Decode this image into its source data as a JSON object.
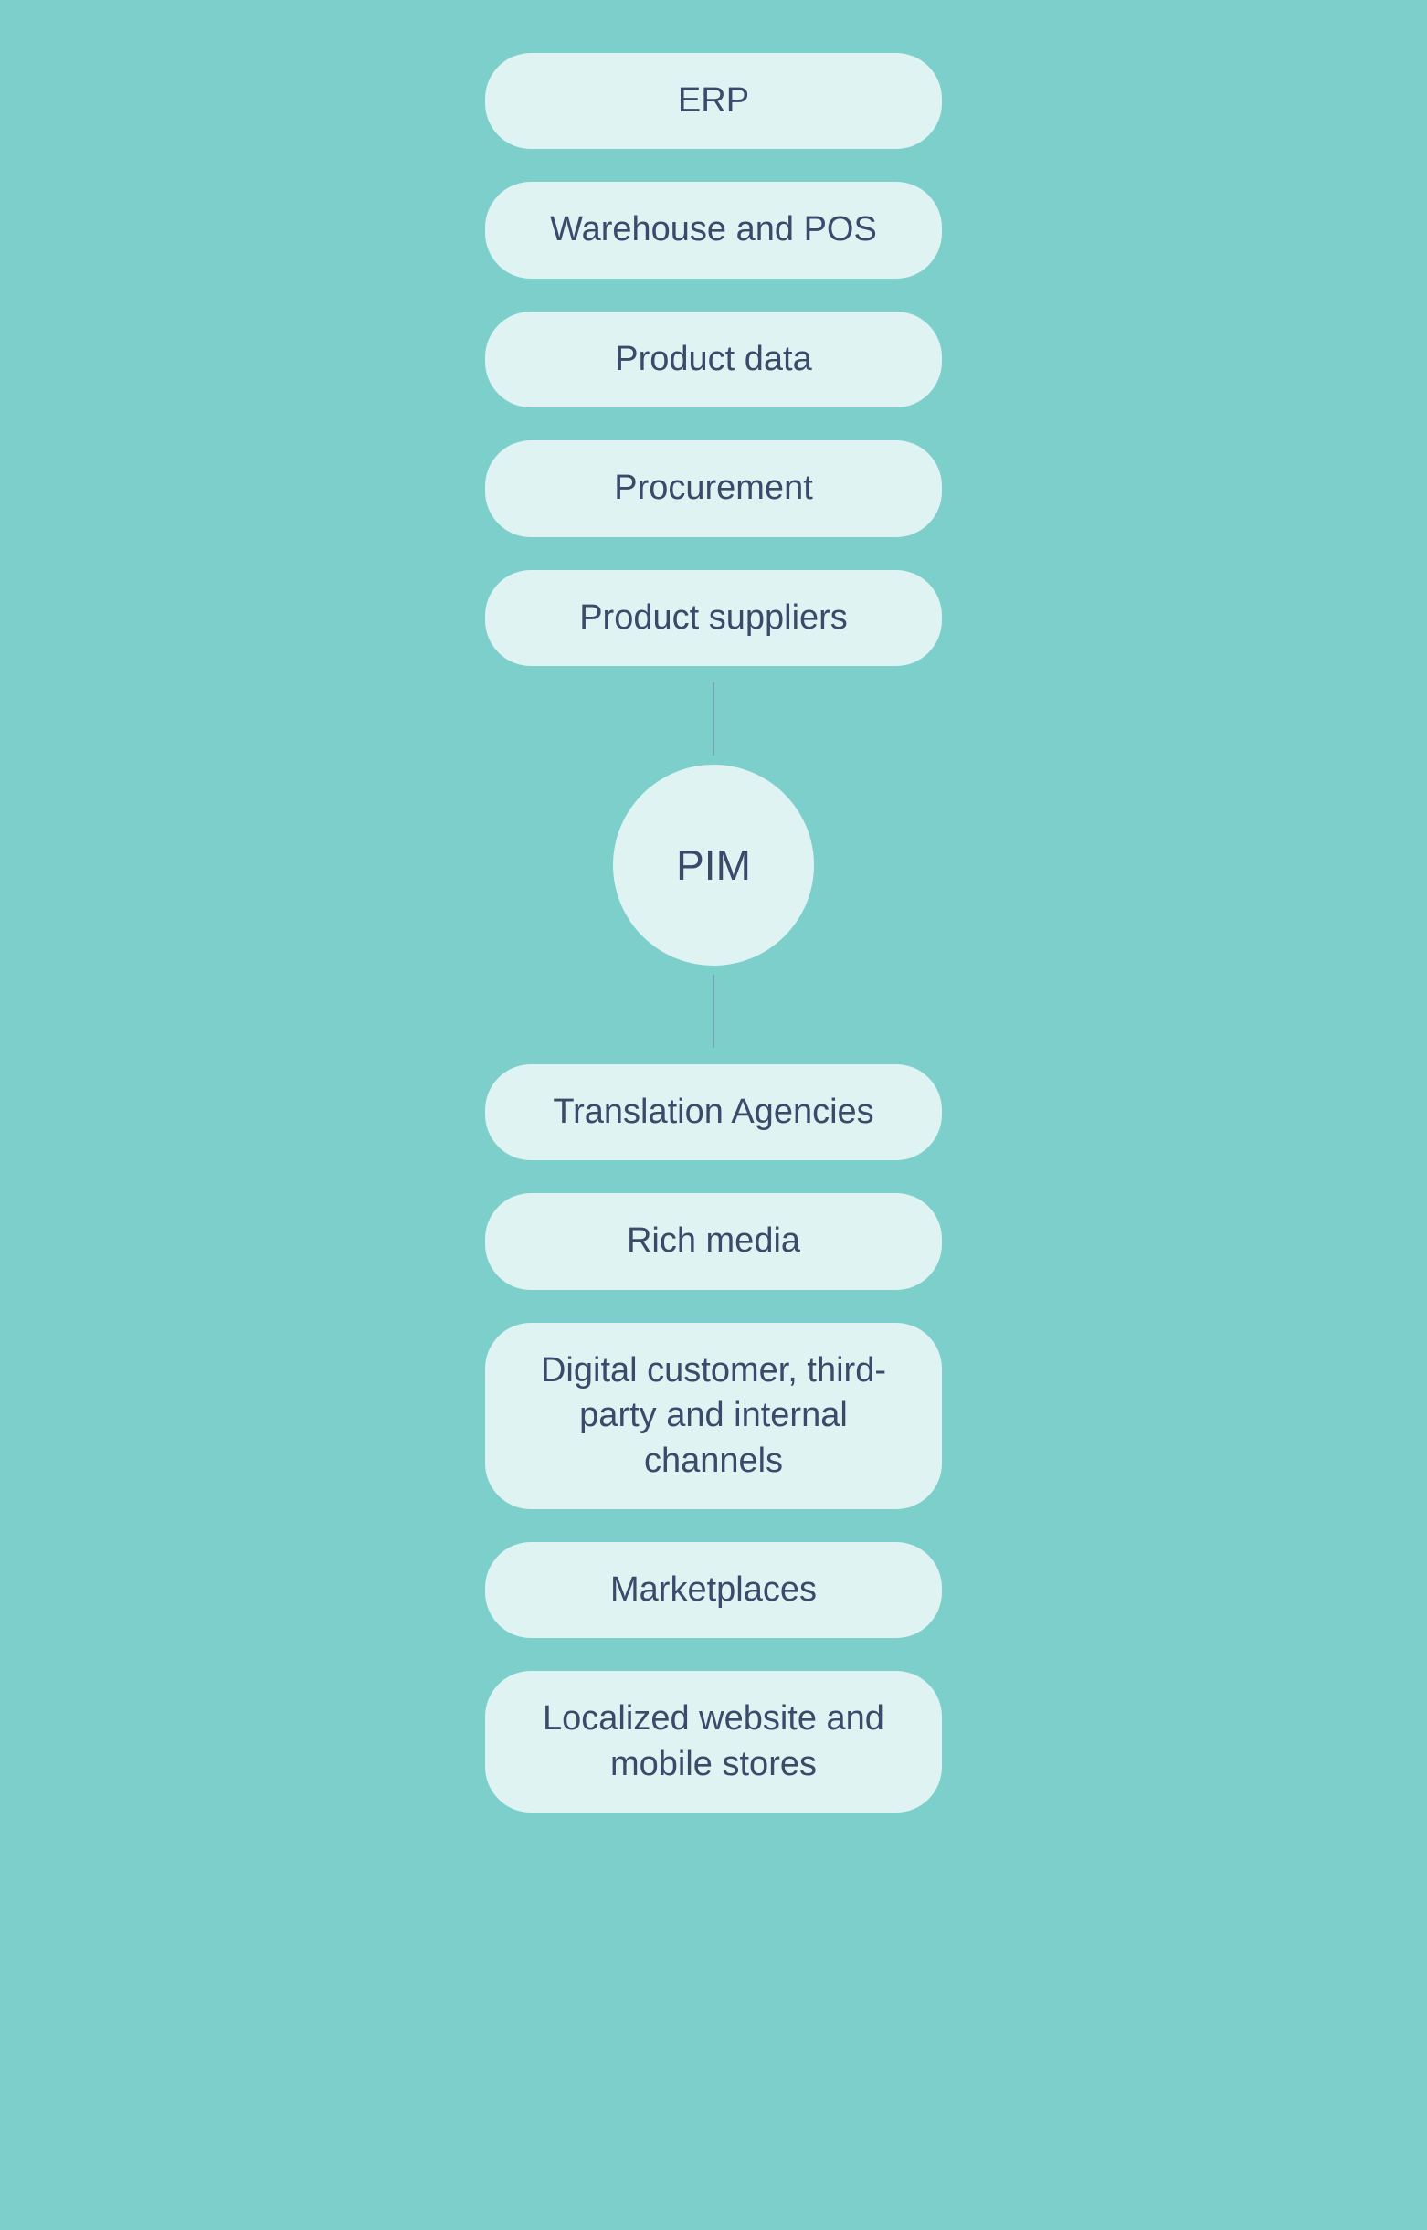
{
  "diagram": {
    "background_color": "#7dcfcc",
    "boxes_above": [
      {
        "id": "erp",
        "label": "ERP"
      },
      {
        "id": "warehouse-pos",
        "label": "Warehouse and POS"
      },
      {
        "id": "product-data",
        "label": "Product data"
      },
      {
        "id": "procurement",
        "label": "Procurement"
      },
      {
        "id": "product-suppliers",
        "label": "Product suppliers"
      }
    ],
    "center": {
      "id": "pim",
      "label": "PIM"
    },
    "boxes_below": [
      {
        "id": "translation-agencies",
        "label": "Translation Agencies"
      },
      {
        "id": "rich-media",
        "label": "Rich media"
      },
      {
        "id": "digital-customer",
        "label": "Digital customer, third-party and internal channels"
      },
      {
        "id": "marketplaces",
        "label": "Marketplaces"
      },
      {
        "id": "localized-website",
        "label": "Localized website and mobile stores"
      }
    ]
  }
}
